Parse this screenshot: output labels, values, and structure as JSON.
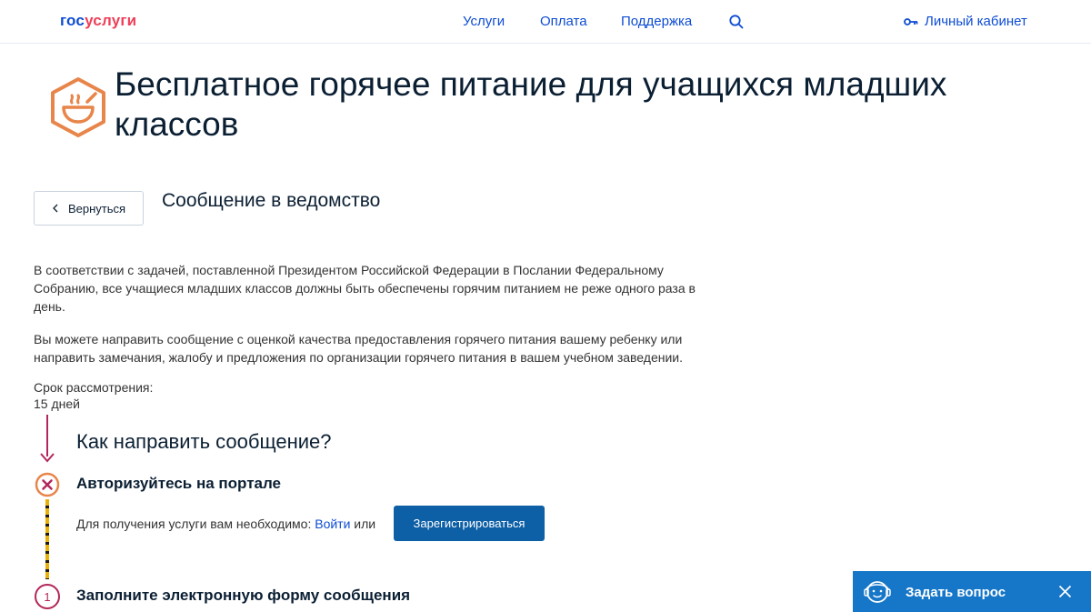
{
  "header": {
    "logo_part1": "гос",
    "logo_part2": "услуги",
    "nav": [
      "Услуги",
      "Оплата",
      "Поддержка"
    ],
    "cabinet_label": "Личный кабинет",
    "icons": {
      "search": "search-icon",
      "key": "key-icon"
    }
  },
  "page": {
    "title": "Бесплатное горячее питание для учащихся младших классов",
    "title_icon": "hot-meal-bowl-icon",
    "back_label": "Вернуться",
    "subtitle": "Сообщение в ведомство",
    "paragraphs": [
      "В соответствии с задачей, поставленной Президентом Российской Федерации в Послании Федеральному Собранию, все учащиеся младших классов должны быть обеспечены горячим питанием не реже одного раза в день.",
      "Вы можете направить сообщение с оценкой качества предоставления горячего питания вашему ребенку или направить замечания, жалобу и предложения по организации горячего питания в вашем учебном заведении."
    ],
    "term_label": "Срок рассмотрения:",
    "term_value": "15 дней"
  },
  "steps": {
    "heading": "Как направить сообщение?",
    "step1": {
      "title": "Авторизуйтесь на портале",
      "text_before": "Для получения услуги вам необходимо: ",
      "login_link": "Войти",
      "text_or": " или",
      "register_label": "Зарегистрироваться"
    },
    "step2": {
      "number": "1",
      "title": "Заполните электронную форму сообщения"
    }
  },
  "ask_widget": {
    "label": "Задать вопрос"
  },
  "colors": {
    "brand_blue": "#0d4cd3",
    "brand_red": "#ee3f58",
    "accent_orange": "#e8854a",
    "step_magenta": "#b3265b",
    "button_blue": "#0d5fa6",
    "widget_blue": "#1676c8"
  }
}
